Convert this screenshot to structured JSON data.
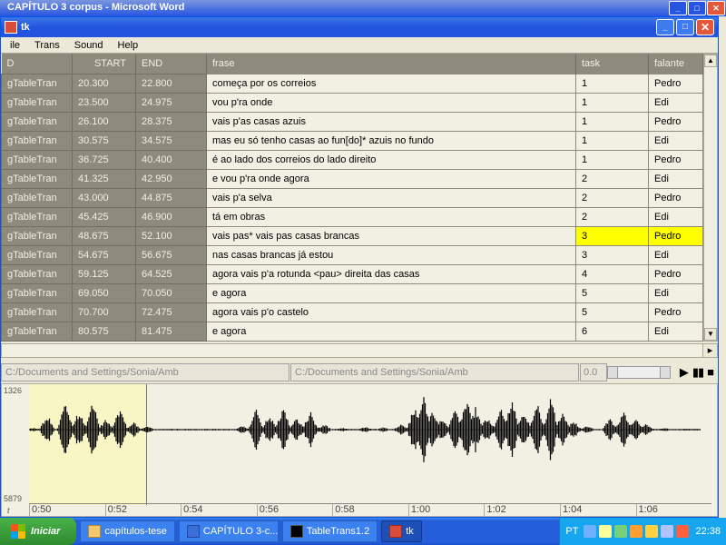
{
  "bg_title": "CAPÍTULO 3 corpus - Microsoft Word",
  "win_title": "tk",
  "menu": {
    "file": "ile",
    "trans": "Trans",
    "sound": "Sound",
    "help": "Help"
  },
  "cols": {
    "id": "D",
    "start": "START",
    "end": "END",
    "frase": "frase",
    "task": "task",
    "falante": "falante"
  },
  "rows": [
    {
      "id": "gTableTran",
      "start": "20.300",
      "end": "22.800",
      "frase": "começa por os correios",
      "task": "1",
      "falante": "Pedro",
      "hl": false
    },
    {
      "id": "gTableTran",
      "start": "23.500",
      "end": "24.975",
      "frase": "vou p'ra onde",
      "task": "1",
      "falante": "Edi",
      "hl": false
    },
    {
      "id": "gTableTran",
      "start": "26.100",
      "end": "28.375",
      "frase": "vais p'as casas azuis",
      "task": "1",
      "falante": "Pedro",
      "hl": false
    },
    {
      "id": "gTableTran",
      "start": "30.575",
      "end": "34.575",
      "frase": "mas eu só tenho casas ao fun[do]* azuis no fundo",
      "task": "1",
      "falante": "Edi",
      "hl": false
    },
    {
      "id": "gTableTran",
      "start": "36.725",
      "end": "40.400",
      "frase": "é ao lado dos correios do lado direito",
      "task": "1",
      "falante": "Pedro",
      "hl": false
    },
    {
      "id": "gTableTran",
      "start": "41.325",
      "end": "42.950",
      "frase": "e vou p'ra onde agora",
      "task": "2",
      "falante": "Edi",
      "hl": false
    },
    {
      "id": "gTableTran",
      "start": "43.000",
      "end": "44.875",
      "frase": "vais p'a selva",
      "task": "2",
      "falante": "Pedro",
      "hl": false
    },
    {
      "id": "gTableTran",
      "start": "45.425",
      "end": "46.900",
      "frase": "tá em obras",
      "task": "2",
      "falante": "Edi",
      "hl": false
    },
    {
      "id": "gTableTran",
      "start": "48.675",
      "end": "52.100",
      "frase": "vais pas* vais pas casas brancas",
      "task": "3",
      "falante": "Pedro",
      "hl": true
    },
    {
      "id": "gTableTran",
      "start": "54.675",
      "end": "56.675",
      "frase": "nas casas brancas já estou",
      "task": "3",
      "falante": "Edi",
      "hl": false
    },
    {
      "id": "gTableTran",
      "start": "59.125",
      "end": "64.525",
      "frase": "agora vais p'a rotunda <pau> direita das casas",
      "task": "4",
      "falante": "Pedro",
      "hl": false
    },
    {
      "id": "gTableTran",
      "start": "69.050",
      "end": "70.050",
      "frase": "e agora",
      "task": "5",
      "falante": "Edi",
      "hl": false
    },
    {
      "id": "gTableTran",
      "start": "70.700",
      "end": "72.475",
      "frase": "agora vais p'o castelo",
      "task": "5",
      "falante": "Pedro",
      "hl": false
    },
    {
      "id": "gTableTran",
      "start": "80.575",
      "end": "81.475",
      "frase": "e agora",
      "task": "6",
      "falante": "Edi",
      "hl": false
    }
  ],
  "path1": "C:/Documents and Settings/Sonia/Amb",
  "path2": "C:/Documents and Settings/Sonia/Amb",
  "zoom": "0.0",
  "wave_top": "1326",
  "wave_bot": "5879",
  "wave_t": "t",
  "times": [
    "0:50",
    "0:52",
    "0:54",
    "0:56",
    "0:58",
    "1:00",
    "1:02",
    "1:04",
    "1:06"
  ],
  "start": "Iniciar",
  "tasks": [
    {
      "label": "capítulos-tese",
      "ico": "ico-folder",
      "active": false
    },
    {
      "label": "CAPÍTULO 3-c...",
      "ico": "ico-word",
      "active": false
    },
    {
      "label": "TableTrans1.2",
      "ico": "ico-cmd",
      "active": false
    },
    {
      "label": "tk",
      "ico": "ico-tk",
      "active": true
    }
  ],
  "lang": "PT",
  "clock": "22:38",
  "tray_colors": [
    "#6fb0ff",
    "#ffff99",
    "#77d077",
    "#ffa030",
    "#ffd040",
    "#b0c4ff",
    "#ff6040"
  ]
}
